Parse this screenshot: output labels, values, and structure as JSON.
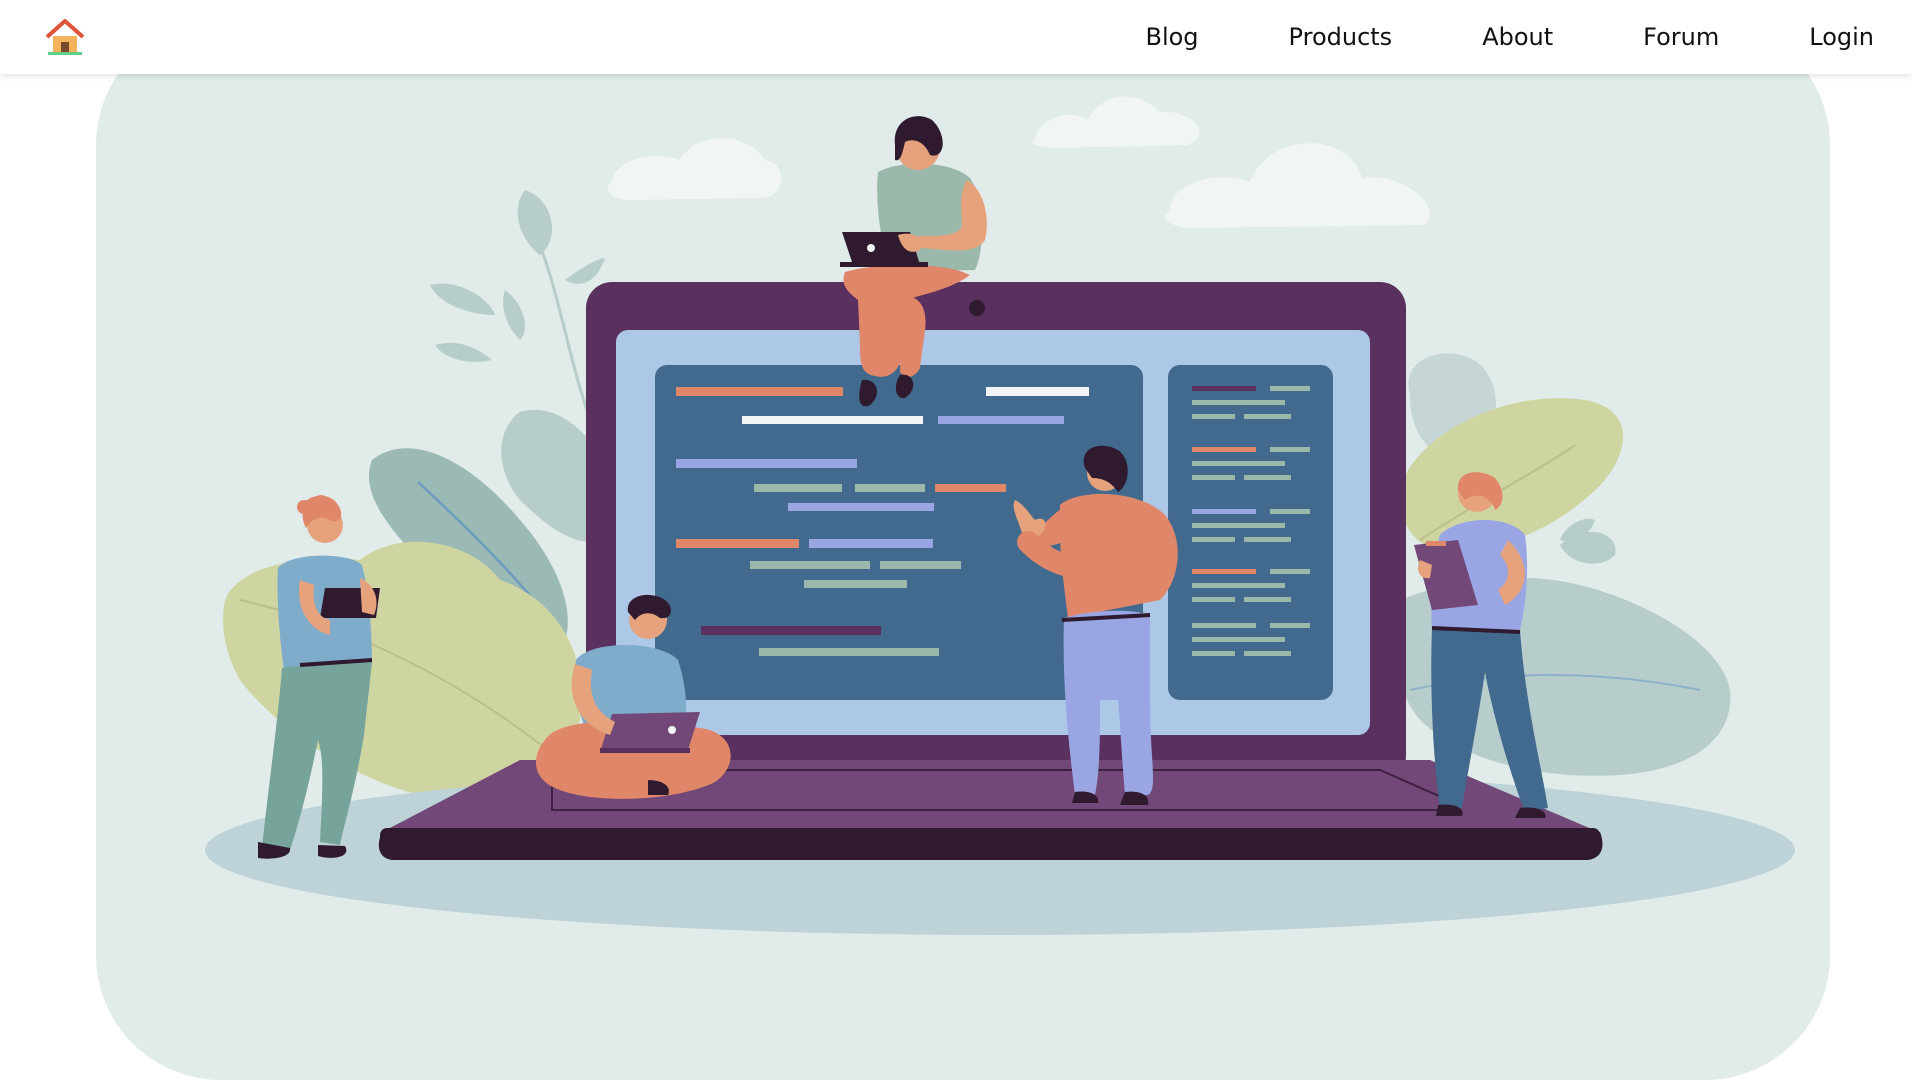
{
  "header": {
    "logo_icon": "house-icon",
    "nav": [
      {
        "label": "Blog"
      },
      {
        "label": "Products"
      },
      {
        "label": "About"
      },
      {
        "label": "Forum"
      },
      {
        "label": "Login"
      }
    ]
  },
  "hero": {
    "illustration": "people-coding-around-giant-laptop",
    "colors": {
      "background": "#e1ebea",
      "laptop_frame": "#5a305e",
      "screen": "#416a8e",
      "accent_orange": "#e0876a",
      "accent_lilac": "#9aa6e4"
    }
  }
}
